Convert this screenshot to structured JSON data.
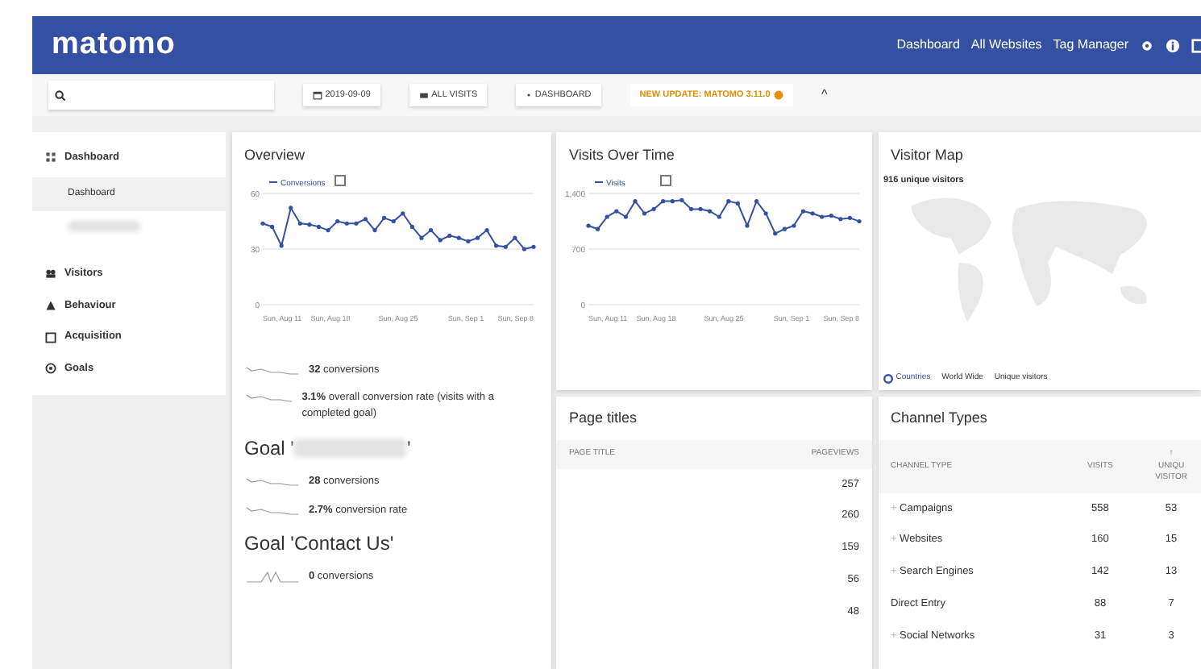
{
  "navbar": {
    "logo": "matomo",
    "links": [
      "Dashboard",
      "All Websites",
      "Tag Manager"
    ]
  },
  "toolbar": {
    "date": "2019-09-09",
    "segment": "ALL VISITS",
    "dashboard": "DASHBOARD",
    "update": "NEW UPDATE: MATOMO 3.11.0",
    "collapse": "^"
  },
  "sidebar": {
    "items": [
      {
        "label": "Dashboard",
        "kind": "category",
        "selected": false
      },
      {
        "label": "Dashboard",
        "kind": "sub",
        "selected": true
      },
      {
        "kind": "redacted",
        "selected": false
      },
      {
        "label": "Visitors",
        "kind": "category",
        "selected": false
      },
      {
        "label": "Behaviour",
        "kind": "category",
        "selected": false
      },
      {
        "label": "Acquisition",
        "kind": "category",
        "selected": false
      },
      {
        "label": "Goals",
        "kind": "category",
        "selected": false
      }
    ]
  },
  "overview": {
    "title": "Overview",
    "legend": "Conversions",
    "y_labels": [
      "60",
      "30",
      "0"
    ],
    "x_labels": [
      "Sun, Aug 11",
      "Sun, Aug 18",
      "Sun, Aug 25",
      "Sun, Sep 1",
      "Sun, Sep 8"
    ],
    "metrics": [
      {
        "value": "32",
        "text": "conversions"
      },
      {
        "value": "3.1%",
        "text": "overall conversion rate (visits with a completed goal)"
      }
    ],
    "goals": [
      {
        "title_start": "Goal '",
        "redacted": true,
        "title_end": "'",
        "metrics": [
          {
            "value": "28",
            "text": "conversions"
          },
          {
            "value": "2.7%",
            "text": "conversion rate"
          }
        ]
      },
      {
        "title_start": "Goal 'Contact Us'",
        "redacted": false,
        "metrics": [
          {
            "value": "0",
            "text": "conversions"
          }
        ]
      }
    ]
  },
  "visits": {
    "title": "Visits Over Time",
    "legend": "Visits",
    "y_labels": [
      "1,400",
      "700",
      "0"
    ],
    "x_labels": [
      "Sun, Aug 11",
      "Sun, Aug 18",
      "Sun, Aug 25",
      "Sun, Sep 1",
      "Sun, Sep 8"
    ]
  },
  "map": {
    "title": "Visitor Map",
    "summary": "916 unique visitors",
    "footer": [
      "Countries",
      "World Wide",
      "Unique visitors"
    ]
  },
  "page_titles": {
    "title": "Page titles",
    "columns": [
      "PAGE TITLE",
      "PAGEVIEWS"
    ],
    "rows": [
      "257",
      "260",
      "159",
      "56",
      "48"
    ]
  },
  "channels": {
    "title": "Channel Types",
    "columns": [
      "CHANNEL TYPE",
      "VISITS",
      "↑ UNIQU VISITOR"
    ],
    "rows": [
      {
        "expand": "+",
        "name": "Campaigns",
        "visits": "558",
        "unique": "53"
      },
      {
        "expand": "+",
        "name": "Websites",
        "visits": "160",
        "unique": "15"
      },
      {
        "expand": "+",
        "name": "Search Engines",
        "visits": "142",
        "unique": "13"
      },
      {
        "name": "Direct Entry",
        "visits": "88",
        "unique": "7"
      },
      {
        "expand": "+",
        "name": "Social Networks",
        "visits": "31",
        "unique": "3"
      }
    ]
  }
}
